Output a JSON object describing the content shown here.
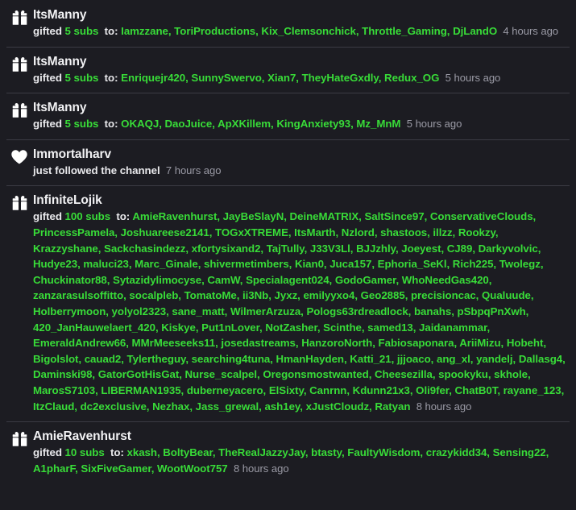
{
  "theme": {
    "background": "#1c1c22",
    "divider": "#3b3b44",
    "primary_text": "#f2f2f4",
    "accent_green": "#38dc38",
    "muted_text": "#9a9aa5"
  },
  "feed": {
    "name": "activity-feed",
    "events": [
      {
        "icon": "gift-icon",
        "actor": "ItsManny",
        "verb": "gifted",
        "count": "5 subs",
        "to_label": "to:",
        "recipients": "Iamzzane, ToriProductions, Kix_Clemsonchick, Throttle_Gaming, DjLandO",
        "timestamp": "4 hours ago"
      },
      {
        "icon": "gift-icon",
        "actor": "ItsManny",
        "verb": "gifted",
        "count": "5 subs",
        "to_label": "to:",
        "recipients": "Enriquejr420, SunnySwervo, Xian7, TheyHateGxdly, Redux_OG",
        "timestamp": "5 hours ago"
      },
      {
        "icon": "gift-icon",
        "actor": "ItsManny",
        "verb": "gifted",
        "count": "5 subs",
        "to_label": "to:",
        "recipients": "OKAQJ, DaoJuice, ApXKillem, KingAnxiety93, Mz_MnM",
        "timestamp": "5 hours ago"
      },
      {
        "icon": "heart-icon",
        "actor": "Immortalharv",
        "follow_text": "just followed the channel",
        "timestamp": "7 hours ago"
      },
      {
        "icon": "gift-icon",
        "actor": "InfiniteLojik",
        "verb": "gifted",
        "count": "100 subs",
        "to_label": "to:",
        "recipients": "AmieRavenhurst, JayBeSlayN, DeineMATRIX, SaltSince97, ConservativeClouds, PrincessPamela, Joshuareese2141, TOGxXTREME, ItsMarth, Nzlord, shastoos, illzz, Rookzy, Krazzyshane, Sackchasindezz, xfortysixand2, TajTully, J33V3Ll, BJJzhly, Joeyest, CJ89, Darkyvolvic, Hudye23, maluci23, Marc_Ginale, shivermetimbers, Kian0, Juca157, Ephoria_SeKl, Rich225, Twolegz, Chuckinator88, Sytazidylimocyse, CamW, Specialagent024, GodoGamer, WhoNeedGas420, zanzarasulsoffitto, socalpleb, TomatoMe, ii3Nb, Jyxz, emilyyxo4, Geo2885, precisioncac, Qualuude, Holberrymoon, yolyol2323, sane_matt, WilmerArzuza, Pologs63rdreadlock, banahs, pSbpqPnXwh, 420_JanHauwelaert_420, Kiskye, Put1nLover, NotZasher, Scinthe, samed13, Jaidanammar, EmeraldAndrew66, MMrMeeseeks11, josedastreams, HanzoroNorth, Fabiosaponara, AriiMizu, Hobeht, Bigolslot, cauad2, Tylertheguy, searching4tuna, HmanHayden, Katti_21, jjjoaco, ang_xl, yandelj, Dallasg4, Daminski98, GatorGotHisGat, Nurse_scalpel, Oregonsmostwanted, Cheesezilla, spookyku, skhole, MarosS7103, LIBERMAN1935, duberneyacero, ElSixty, Canrnn, Kdunn21x3, Oli9fer, ChatB0T, rayane_123, ItzClaud, dc2exclusive, Nezhax, Jass_grewal, ash1ey, xJustCloudz, Ratyan",
        "timestamp": "8 hours ago"
      },
      {
        "icon": "gift-icon",
        "actor": "AmieRavenhurst",
        "verb": "gifted",
        "count": "10 subs",
        "to_label": "to:",
        "recipients": "xkash, BoltyBear, TheRealJazzyJay, btasty, FaultyWisdom, crazykidd34, Sensing22, A1pharF, SixFiveGamer, WootWoot757",
        "timestamp": "8 hours ago"
      }
    ]
  }
}
